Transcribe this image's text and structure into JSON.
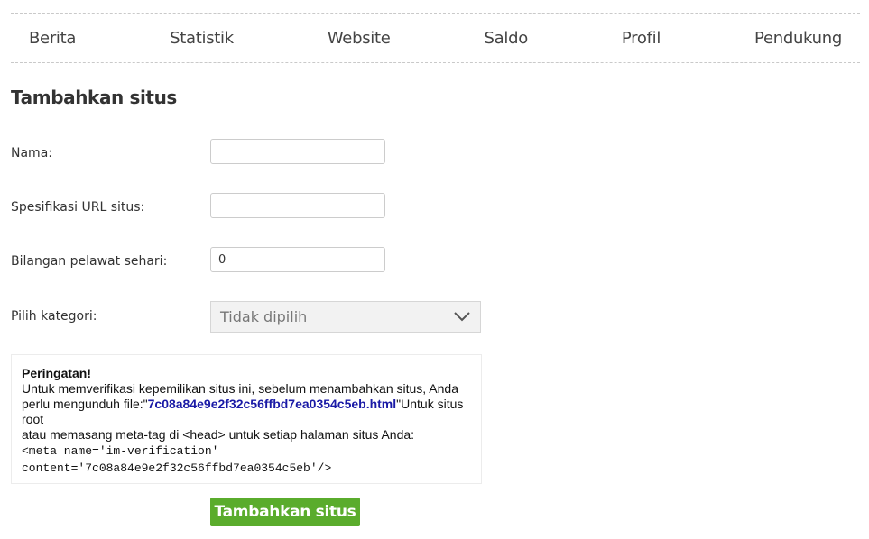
{
  "nav": {
    "items": [
      {
        "label": "Berita"
      },
      {
        "label": "Statistik"
      },
      {
        "label": "Website"
      },
      {
        "label": "Saldo"
      },
      {
        "label": "Profil"
      },
      {
        "label": "Pendukung"
      }
    ]
  },
  "page": {
    "title": "Tambahkan situs"
  },
  "form": {
    "name": {
      "label": "Nama:",
      "value": ""
    },
    "url": {
      "label": "Spesifikasi URL situs:",
      "value": ""
    },
    "visitors": {
      "label": "Bilangan pelawat sehari:",
      "value": "0"
    },
    "category": {
      "label": "Pilih kategori:",
      "selected": "Tidak dipilih"
    }
  },
  "warning": {
    "title": "Peringatan!",
    "text_before_link": "Untuk memverifikasi kepemilikan situs ini, sebelum menambahkan situs, Anda perlu mengunduh file:\"",
    "file_name": "7c08a84e9e2f32c56ffbd7ea0354c5eb.html",
    "text_after_link": "\"Untuk situs root",
    "meta_text": "atau memasang meta-tag di <head> untuk setiap halaman situs Anda:",
    "code_line1": "<meta name='im-verification'",
    "code_line2": "content='7c08a84e9e2f32c56ffbd7ea0354c5eb'/>"
  },
  "submit": {
    "label": "Tambahkan situs"
  },
  "colors": {
    "accent_green": "#5aac2c",
    "link_blue": "#1a1aa6"
  }
}
